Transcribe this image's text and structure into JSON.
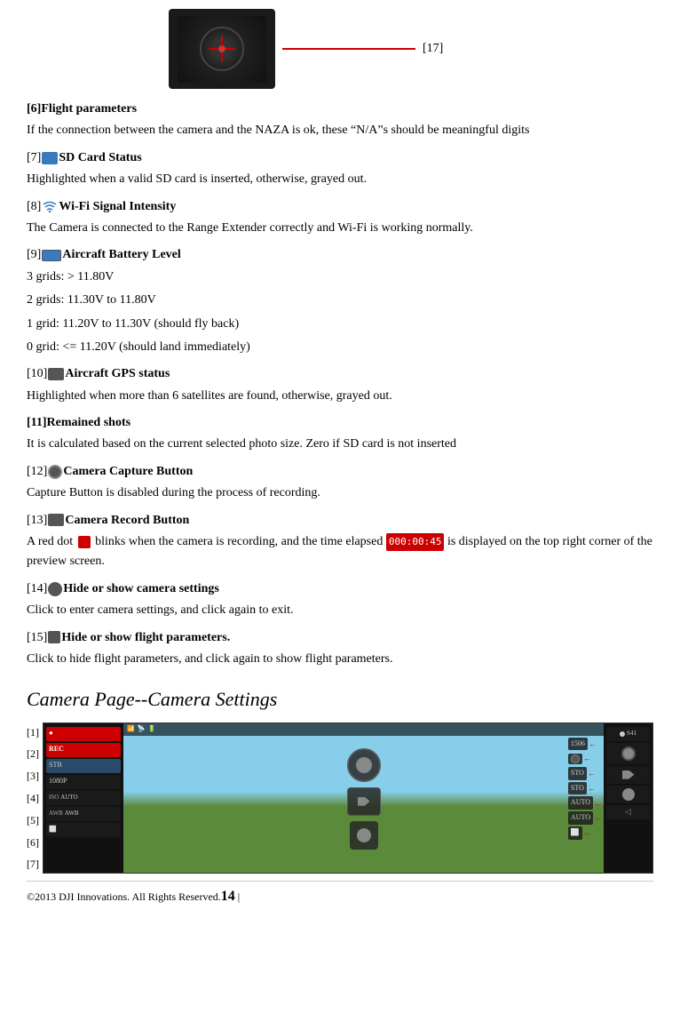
{
  "top": {
    "bracket_label": "[17]",
    "camera_alt": "Camera dial image"
  },
  "sections": [
    {
      "id": "s6",
      "header": "[6]Flight parameters",
      "body": "If the connection between the camera and the NAZA is ok, these “N/A”s should be meaningful digits"
    },
    {
      "id": "s7",
      "header_prefix": "[7]",
      "header_icon": "sd-card-icon",
      "header_text": "SD Card Status",
      "body": "Highlighted when a valid SD card is inserted, otherwise, grayed out."
    },
    {
      "id": "s8",
      "header_prefix": "[8]",
      "header_icon": "wifi-icon",
      "header_text": "Wi-Fi Signal Intensity",
      "body": "The Camera is connected to the Range Extender correctly and Wi-Fi is working normally."
    },
    {
      "id": "s9",
      "header_prefix": "[9]",
      "header_icon": "battery-icon",
      "header_text": "Aircraft Battery Level",
      "body1": "3 grids: > 11.80V",
      "body2": "2 grids: 11.30V to 11.80V",
      "body3": "1 grid: 11.20V to 11.30V (should fly back)",
      "body4": "0 grid: <= 11.20V (should land immediately)"
    },
    {
      "id": "s10",
      "header_prefix": "[10]",
      "header_icon": "gps-icon",
      "header_text": "Aircraft GPS status",
      "body": "Highlighted when more than 6 satellites are found, otherwise, grayed out."
    },
    {
      "id": "s11",
      "header": "[11]Remained shots",
      "body": "It is calculated based on the current selected photo size. Zero if SD card is not inserted"
    },
    {
      "id": "s12",
      "header_prefix": "[12]",
      "header_icon": "camera-capture-icon",
      "header_text": "Camera Capture Button",
      "body": "Capture Button is disabled during the process of recording."
    },
    {
      "id": "s13",
      "header_prefix": "[13]",
      "header_icon": "camera-record-icon",
      "header_text": "Camera Record Button",
      "body_before": "A red dot",
      "body_middle": " blinks when the camera is recording, and the time elapsed",
      "time_display": "000:00:45",
      "body_after": " is displayed on the top right corner of the preview screen."
    },
    {
      "id": "s14",
      "header_prefix": "[14]",
      "header_icon": "camera-settings-icon",
      "header_text": "Hide or show camera settings",
      "body": "Click to enter camera settings, and click again to exit."
    },
    {
      "id": "s15",
      "header_prefix": "[15]",
      "header_icon": "flight-params-icon",
      "header_text": "Hide or show flight parameters.",
      "body": "Click to hide flight parameters, and click again to show flight parameters."
    }
  ],
  "camera_page_section": {
    "title": "Camera Page--Camera Settings",
    "labels": [
      "[1]",
      "[2]",
      "[3]",
      "[4]",
      "[5]",
      "[6]",
      "[7]"
    ],
    "left_items": [
      {
        "text": "",
        "has_red": true
      },
      {
        "text": "REC",
        "has_red": true
      },
      {
        "text": "STB",
        "has_red": false
      },
      {
        "text": "1080P",
        "has_red": false
      },
      {
        "text": "ISO AUTO",
        "has_red": false
      },
      {
        "text": "AWB",
        "has_red": false
      },
      {
        "text": "",
        "has_red": false
      }
    ],
    "center_items": [
      "1506",
      "photo",
      "video",
      "STO",
      "STO",
      "AUTO",
      ""
    ],
    "right_items": [
      "S41",
      "",
      "",
      "",
      ""
    ],
    "top_bar_items": [
      "WiFi",
      "GPS",
      "BAT"
    ]
  },
  "footer": {
    "text": "©2013 DJI Innovations. All Rights Reserved.",
    "page_number": "14"
  }
}
